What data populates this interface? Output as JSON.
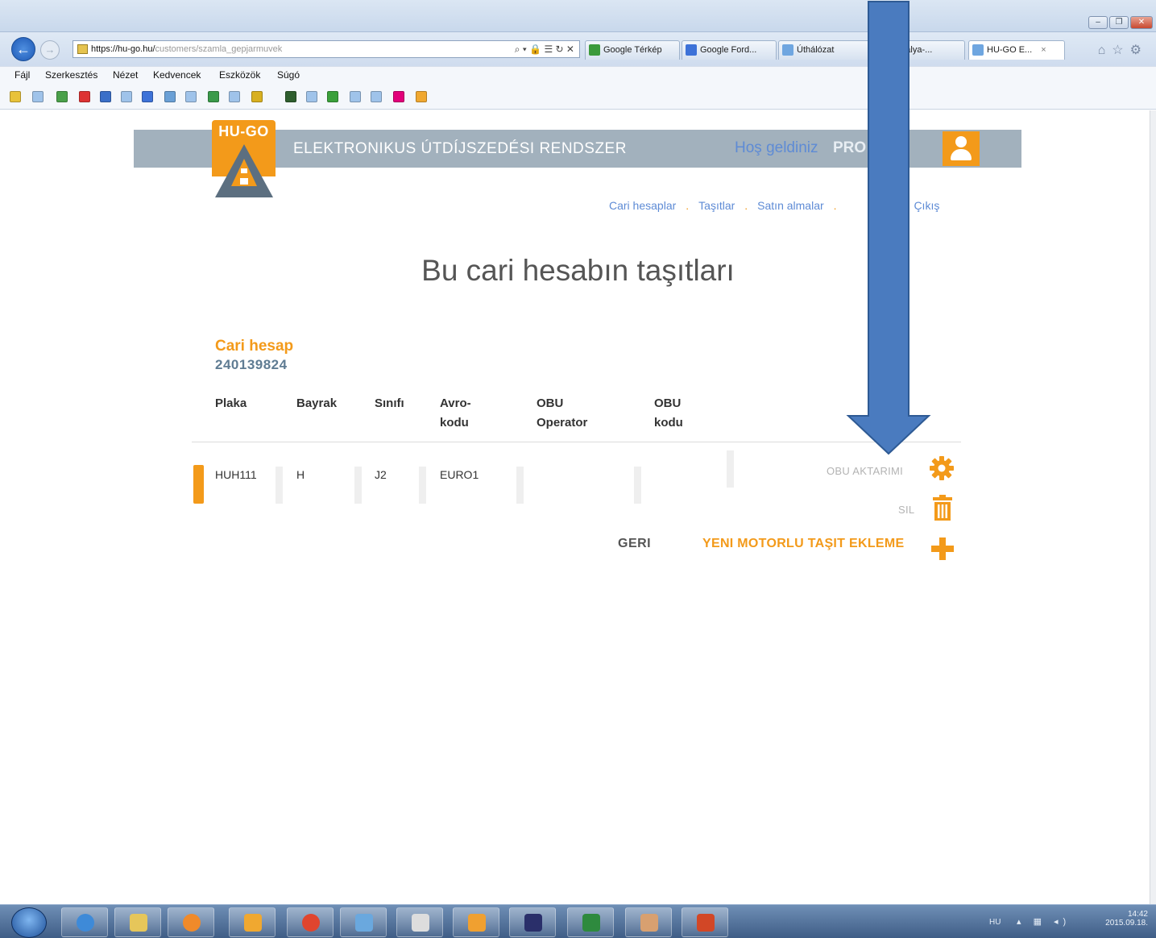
{
  "browser": {
    "address": {
      "host": "https://hu-go.hu/",
      "path": "customers/szamla_gepjarmuvek",
      "tools": "⌕ ▾ 🔒 ☰ ↻ ✕"
    },
    "tabs": [
      {
        "label": "Google Térkép",
        "color": "#3b9a3b"
      },
      {
        "label": "Google Ford...",
        "color": "#3d72d8"
      },
      {
        "label": "Úthálózat",
        "color": "#6fa6e0"
      },
      {
        "label": "tópálya-...",
        "color": "#6fa6e0"
      },
      {
        "label": "HU-GO E...",
        "color": "#6fa6e0",
        "close": "×"
      }
    ],
    "menu": [
      "Fájl",
      "Szerkesztés",
      "Nézet",
      "Kedvencek",
      "Eszközök",
      "Súgó"
    ]
  },
  "site": {
    "logo_text": "HU-GO",
    "title": "ELEKTRONIKUS ÚTDÍJSZEDÉSI RENDSZER",
    "welcome": "Hoş geldiniz",
    "username": "PRO    D",
    "nav": [
      "Cari hesaplar",
      "Taşıtlar",
      "Satın almalar",
      "Çıkış"
    ]
  },
  "page": {
    "title": "Bu cari hesabın taşıtları",
    "account_label": "Cari hesap",
    "account_number": "240139824",
    "columns": [
      "Plaka",
      "Bayrak",
      "Sınıfı",
      "Avro-\nkodu",
      "OBU\nOperator",
      "OBU\nkodu"
    ],
    "rows": [
      {
        "plate": "HUH111",
        "flag": "H",
        "class": "J2",
        "euro": "EURO1",
        "obu_operator": "",
        "obu_code": ""
      }
    ],
    "actions": {
      "obu_transfer": "OBU AKTARIMI",
      "delete": "SIL"
    },
    "back": "GERI",
    "add_vehicle": "YENI MOTORLU TAŞIT EKLEME"
  },
  "taskbar": {
    "lang": "HU",
    "time": "14:42",
    "date": "2015.09.18."
  },
  "colors": {
    "accent": "#f39a1a",
    "header_gray": "#a2b1bd",
    "link_blue": "#5e8bd5",
    "arrow_blue": "#4a7bbf"
  }
}
